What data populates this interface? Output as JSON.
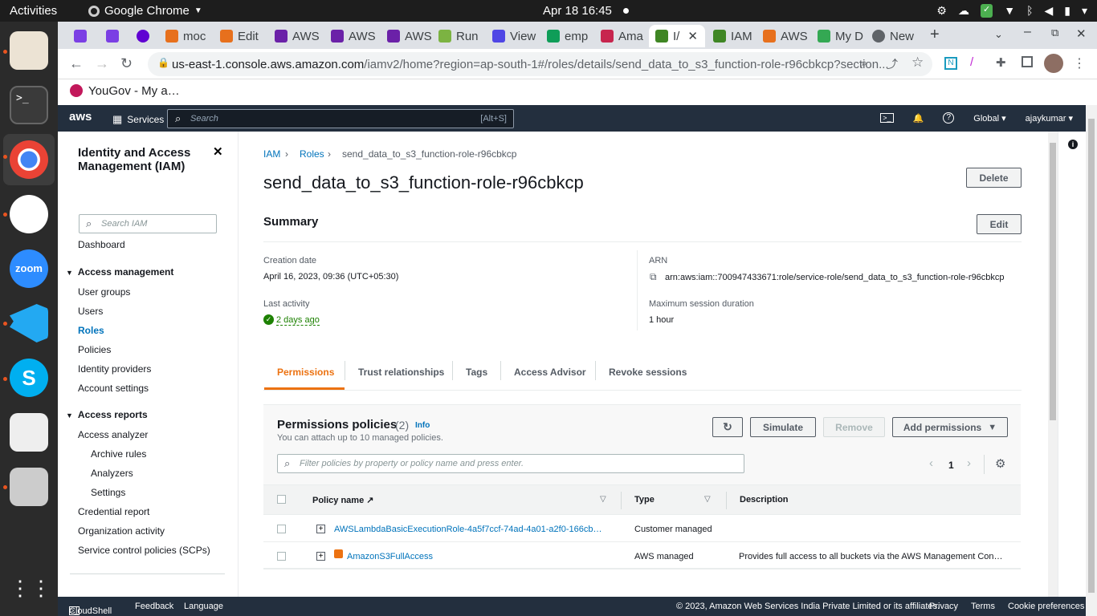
{
  "os": {
    "activities": "Activities",
    "app_name": "Google Chrome",
    "clock": "Apr 18  16:45"
  },
  "browser": {
    "tabs": [
      {
        "label": ""
      },
      {
        "label": ""
      },
      {
        "label": ""
      },
      {
        "label": "moc"
      },
      {
        "label": "Edit"
      },
      {
        "label": "AWS"
      },
      {
        "label": "AWS"
      },
      {
        "label": "AWS"
      },
      {
        "label": "Run"
      },
      {
        "label": "View"
      },
      {
        "label": "emp"
      },
      {
        "label": "Ama"
      },
      {
        "label": "I/"
      },
      {
        "label": "IAM"
      },
      {
        "label": "AWS"
      },
      {
        "label": "My D"
      },
      {
        "label": "New"
      }
    ],
    "url_host": "us-east-1.console.aws.amazon.com",
    "url_path": "/iamv2/home?region=ap-south-1#/roles/details/send_data_to_s3_function-role-r96cbkcp?section...",
    "bookmark": "YouGov - My a…"
  },
  "aws_nav": {
    "logo": "aws",
    "services": "Services",
    "search_placeholder": "Search",
    "search_shortcut": "[Alt+S]",
    "region": "Global",
    "user": "ajaykumar"
  },
  "sidebar": {
    "title": "Identity and Access Management (IAM)",
    "search_placeholder": "Search IAM",
    "dashboard": "Dashboard",
    "access_management": "Access management",
    "user_groups": "User groups",
    "users": "Users",
    "roles": "Roles",
    "policies": "Policies",
    "identity_providers": "Identity providers",
    "account_settings": "Account settings",
    "access_reports": "Access reports",
    "access_analyzer": "Access analyzer",
    "archive_rules": "Archive rules",
    "analyzers": "Analyzers",
    "settings": "Settings",
    "credential_report": "Credential report",
    "organization_activity": "Organization activity",
    "scps": "Service control policies (SCPs)"
  },
  "breadcrumb": {
    "iam": "IAM",
    "roles": "Roles",
    "current": "send_data_to_s3_function-role-r96cbkcp"
  },
  "role": {
    "name": "send_data_to_s3_function-role-r96cbkcp",
    "delete_label": "Delete",
    "summary_title": "Summary",
    "edit_label": "Edit",
    "creation_label": "Creation date",
    "creation_value": "April 16, 2023, 09:36 (UTC+05:30)",
    "arn_label": "ARN",
    "arn_value": "arn:aws:iam::700947433671:role/service-role/send_data_to_s3_function-role-r96cbkcp",
    "last_activity_label": "Last activity",
    "last_activity_value": "2 days ago",
    "max_session_label": "Maximum session duration",
    "max_session_value": "1 hour"
  },
  "tabs": {
    "permissions": "Permissions",
    "trust": "Trust relationships",
    "tags": "Tags",
    "advisor": "Access Advisor",
    "revoke": "Revoke sessions"
  },
  "policies": {
    "title": "Permissions policies",
    "count": "(2)",
    "info": "Info",
    "subtitle": "You can attach up to 10 managed policies.",
    "simulate": "Simulate",
    "remove": "Remove",
    "add_permissions": "Add permissions",
    "filter_placeholder": "Filter policies by property or policy name and press enter.",
    "page": "1",
    "col_name": "Policy name",
    "col_type": "Type",
    "col_desc": "Description",
    "rows": [
      {
        "name": "AWSLambdaBasicExecutionRole-4a5f7ccf-74ad-4a01-a2f0-166cb…",
        "type": "Customer managed",
        "desc": ""
      },
      {
        "name": "AmazonS3FullAccess",
        "type": "AWS managed",
        "desc": "Provides full access to all buckets via the AWS Management Con…"
      }
    ]
  },
  "footer": {
    "cloudshell": "CloudShell",
    "feedback": "Feedback",
    "language": "Language",
    "copyright": "© 2023, Amazon Web Services India Private Limited or its affiliates.",
    "privacy": "Privacy",
    "terms": "Terms",
    "cookies": "Cookie preferences"
  },
  "colors": {
    "aws_nav": "#232f3e",
    "link": "#0073bb",
    "active_tab": "#ec7211",
    "success": "#1d8102"
  }
}
